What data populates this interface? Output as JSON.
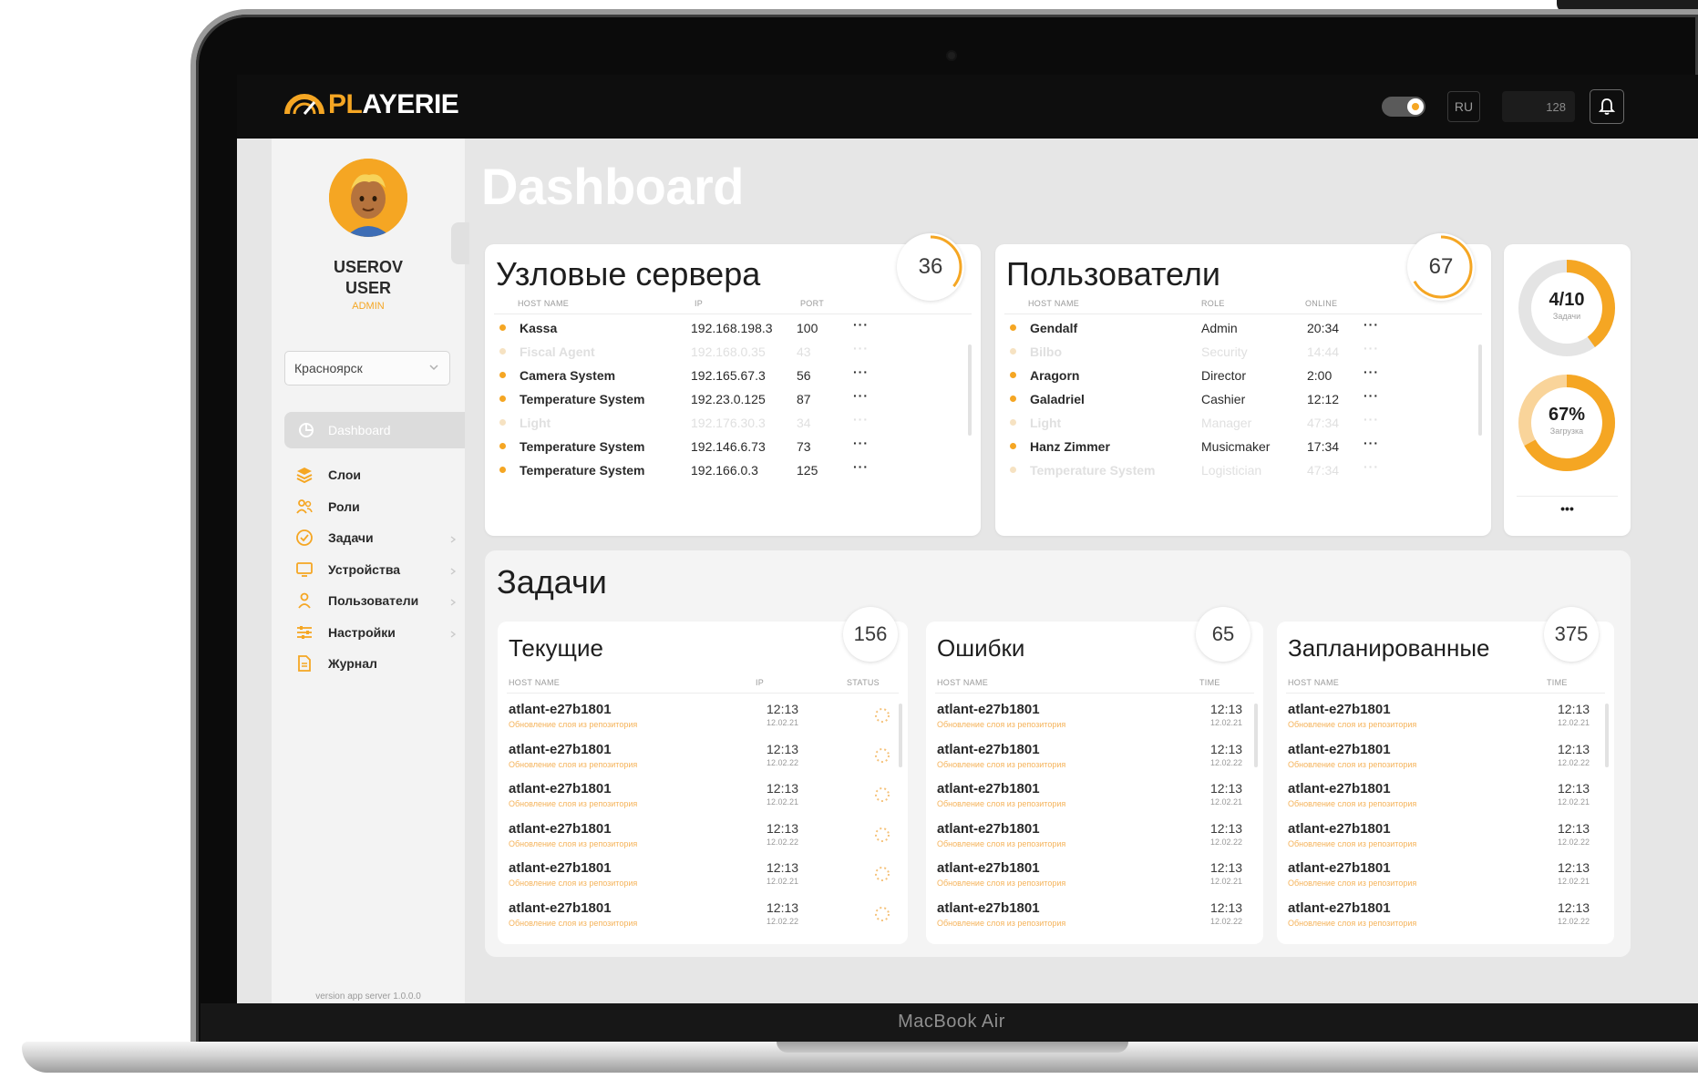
{
  "device": {
    "label": "MacBook Air"
  },
  "colors": {
    "accent": "#f5a623",
    "topbar": "#0e0e0e",
    "screen_bg": "#e6e6e6",
    "card_bg": "#ffffff"
  },
  "topbar": {
    "logo_prefix": "PL",
    "logo_rest": "AYERIE",
    "logo_icon": "speedometer-icon",
    "theme_toggle": "on",
    "language": "RU",
    "counter": "128",
    "bell_icon": "bell-icon"
  },
  "sidebar": {
    "user_first": "USEROV",
    "user_second": "USER",
    "role": "ADMIN",
    "city": "Красноярск",
    "active_item": "Dashboard",
    "items": [
      {
        "label": "Слои",
        "icon": "layers-icon",
        "has_arrow": false
      },
      {
        "label": "Роли",
        "icon": "users-icon",
        "has_arrow": false
      },
      {
        "label": "Задачи",
        "icon": "check-circle-icon",
        "has_arrow": true
      },
      {
        "label": "Устройства",
        "icon": "monitor-icon",
        "has_arrow": true
      },
      {
        "label": "Пользователи",
        "icon": "user-icon",
        "has_arrow": true
      },
      {
        "label": "Настройки",
        "icon": "sliders-icon",
        "has_arrow": true
      },
      {
        "label": "Журнал",
        "icon": "document-icon",
        "has_arrow": false
      }
    ],
    "version": "version app server 1.0.0.0"
  },
  "page_title": "Dashboard",
  "servers": {
    "title": "Узловые сервера",
    "count": "36",
    "count_fill": 0.36,
    "headers": [
      "HOST NAME",
      "IP",
      "PORT"
    ],
    "rows": [
      {
        "name": "Kassa",
        "ip": "192.168.198.3",
        "port": "100",
        "faded": false
      },
      {
        "name": "Fiscal Agent",
        "ip": "192.168.0.35",
        "port": "43",
        "faded": true
      },
      {
        "name": "Camera System",
        "ip": "192.165.67.3",
        "port": "56",
        "faded": false
      },
      {
        "name": "Temperature System",
        "ip": "192.23.0.125",
        "port": "87",
        "faded": false
      },
      {
        "name": "Light",
        "ip": "192.176.30.3",
        "port": "34",
        "faded": true
      },
      {
        "name": "Temperature System",
        "ip": "192.146.6.73",
        "port": "73",
        "faded": false
      },
      {
        "name": "Temperature System",
        "ip": "192.166.0.3",
        "port": "125",
        "faded": false
      }
    ]
  },
  "users": {
    "title": "Пользователи",
    "count": "67",
    "count_fill": 0.67,
    "headers": [
      "HOST NAME",
      "ROLE",
      "ONLINE"
    ],
    "rows": [
      {
        "name": "Gendalf",
        "role": "Admin",
        "time": "20:34",
        "faded": false
      },
      {
        "name": "Bilbo",
        "role": "Security",
        "time": "14:44",
        "faded": true
      },
      {
        "name": "Aragorn",
        "role": "Director",
        "time": "2:00",
        "faded": false
      },
      {
        "name": "Galadriel",
        "role": "Cashier",
        "time": "12:12",
        "faded": false
      },
      {
        "name": "Light",
        "role": "Manager",
        "time": "47:34",
        "faded": true
      },
      {
        "name": "Hanz Zimmer",
        "role": "Musicmaker",
        "time": "17:34",
        "faded": false
      },
      {
        "name": "Temperature System",
        "role": "Logistician",
        "time": "47:34",
        "faded": true
      }
    ]
  },
  "stats": {
    "tasks_done": {
      "label": "4/10",
      "sub": "Задачи",
      "fraction": 0.4
    },
    "load": {
      "label": "67%",
      "sub": "Загрузка",
      "fraction": 0.67
    },
    "more": "•••"
  },
  "tasks": {
    "title": "Задачи",
    "current": {
      "title": "Текущие",
      "count": "156",
      "headers": [
        "HOST NAME",
        "IP",
        "STATUS"
      ],
      "rows": [
        {
          "name": "atlant-e27b1801",
          "desc": "Обновление слоя из репозитория",
          "time": "12:13",
          "date": "12.02.21"
        },
        {
          "name": "atlant-e27b1801",
          "desc": "Обновление слоя из репозитория",
          "time": "12:13",
          "date": "12.02.22"
        },
        {
          "name": "atlant-e27b1801",
          "desc": "Обновление слоя из репозитория",
          "time": "12:13",
          "date": "12.02.21"
        },
        {
          "name": "atlant-e27b1801",
          "desc": "Обновление слоя из репозитория",
          "time": "12:13",
          "date": "12.02.22"
        },
        {
          "name": "atlant-e27b1801",
          "desc": "Обновление слоя из репозитория",
          "time": "12:13",
          "date": "12.02.21"
        },
        {
          "name": "atlant-e27b1801",
          "desc": "Обновление слоя из репозитория",
          "time": "12:13",
          "date": "12.02.22"
        }
      ]
    },
    "errors": {
      "title": "Ошибки",
      "count": "65",
      "headers": [
        "HOST NAME",
        "TIME"
      ],
      "rows": [
        {
          "name": "atlant-e27b1801",
          "desc": "Обновление слоя из репозитория",
          "time": "12:13",
          "date": "12.02.21"
        },
        {
          "name": "atlant-e27b1801",
          "desc": "Обновление слоя из репозитория",
          "time": "12:13",
          "date": "12.02.22"
        },
        {
          "name": "atlant-e27b1801",
          "desc": "Обновление слоя из репозитория",
          "time": "12:13",
          "date": "12.02.21"
        },
        {
          "name": "atlant-e27b1801",
          "desc": "Обновление слоя из репозитория",
          "time": "12:13",
          "date": "12.02.22"
        },
        {
          "name": "atlant-e27b1801",
          "desc": "Обновление слоя из репозитория",
          "time": "12:13",
          "date": "12.02.21"
        },
        {
          "name": "atlant-e27b1801",
          "desc": "Обновление слоя из репозитория",
          "time": "12:13",
          "date": "12.02.22"
        }
      ]
    },
    "scheduled": {
      "title": "Запланированные",
      "count": "375",
      "headers": [
        "HOST NAME",
        "TIME"
      ],
      "rows": [
        {
          "name": "atlant-e27b1801",
          "desc": "Обновление слоя из репозитория",
          "time": "12:13",
          "date": "12.02.21"
        },
        {
          "name": "atlant-e27b1801",
          "desc": "Обновление слоя из репозитория",
          "time": "12:13",
          "date": "12.02.22"
        },
        {
          "name": "atlant-e27b1801",
          "desc": "Обновление слоя из репозитория",
          "time": "12:13",
          "date": "12.02.21"
        },
        {
          "name": "atlant-e27b1801",
          "desc": "Обновление слоя из репозитория",
          "time": "12:13",
          "date": "12.02.22"
        },
        {
          "name": "atlant-e27b1801",
          "desc": "Обновление слоя из репозитория",
          "time": "12:13",
          "date": "12.02.21"
        },
        {
          "name": "atlant-e27b1801",
          "desc": "Обновление слоя из репозитория",
          "time": "12:13",
          "date": "12.02.22"
        }
      ]
    }
  }
}
